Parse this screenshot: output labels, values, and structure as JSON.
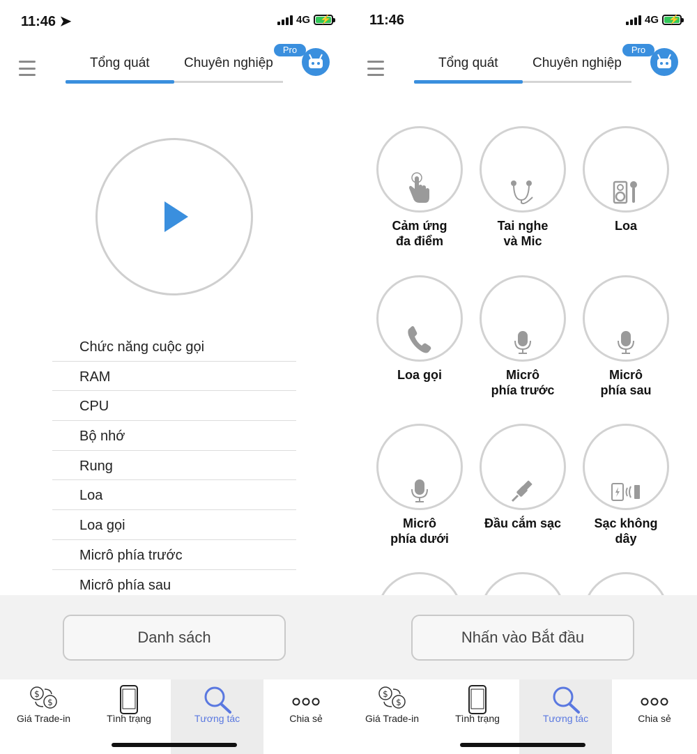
{
  "left": {
    "status": {
      "time": "11:46",
      "network": "4G"
    },
    "tabs": {
      "general": "Tổng quát",
      "professional": "Chuyên nghiệp",
      "pro_badge": "Pro"
    },
    "test_list": [
      "Chức năng cuộc gọi",
      "RAM",
      "CPU",
      "Bộ nhớ",
      "Rung",
      "Loa",
      "Loa gọi",
      "Micrô phía trước",
      "Micrô phía sau"
    ],
    "main_button": "Danh sách"
  },
  "right": {
    "status": {
      "time": "11:46",
      "network": "4G"
    },
    "tabs": {
      "general": "Tổng quát",
      "professional": "Chuyên nghiệp",
      "pro_badge": "Pro"
    },
    "tests": [
      {
        "line1": "Cảm ứng",
        "line2": "đa điểm",
        "icon": "multitouch-icon"
      },
      {
        "line1": "Tai nghe",
        "line2": "và Mic",
        "icon": "headphones-icon"
      },
      {
        "line1": "Loa",
        "line2": "",
        "icon": "speaker-icon"
      },
      {
        "line1": "Loa gọi",
        "line2": "",
        "icon": "phone-icon"
      },
      {
        "line1": "Micrô",
        "line2": "phía trước",
        "icon": "microphone-icon"
      },
      {
        "line1": "Micrô",
        "line2": "phía sau",
        "icon": "microphone-icon"
      },
      {
        "line1": "Micrô",
        "line2": "phía dưới",
        "icon": "microphone-icon"
      },
      {
        "line1": "Đầu cắm sạc",
        "line2": "",
        "icon": "usb-cable-icon"
      },
      {
        "line1": "Sạc không",
        "line2": "dây",
        "icon": "wireless-charging-icon"
      }
    ],
    "main_button": "Nhấn vào Bắt đầu"
  },
  "nav": {
    "tradein": "Giá Trade-in",
    "status": "Tình trạng",
    "interaction": "Tương tác",
    "share": "Chia sẻ"
  },
  "colors": {
    "accent": "#3a8fde",
    "active_nav": "#5a78e0",
    "battery": "#34c759"
  }
}
